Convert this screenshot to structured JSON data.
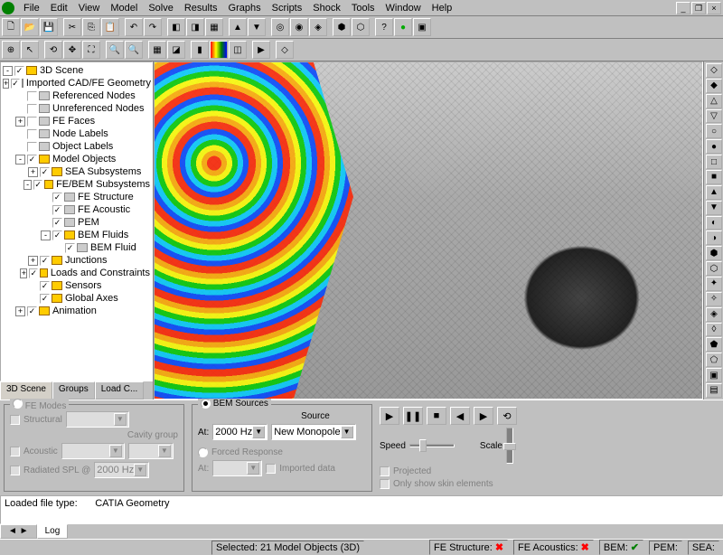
{
  "menu": [
    "File",
    "Edit",
    "View",
    "Model",
    "Solve",
    "Results",
    "Graphs",
    "Scripts",
    "Shock",
    "Tools",
    "Window",
    "Help"
  ],
  "tree": {
    "root": "3D Scene",
    "items": [
      {
        "indent": 1,
        "exp": "+",
        "chk": true,
        "icon": "gray",
        "label": "Imported CAD/FE Geometry"
      },
      {
        "indent": 1,
        "exp": "",
        "chk": false,
        "icon": "gray",
        "label": "Referenced Nodes"
      },
      {
        "indent": 1,
        "exp": "",
        "chk": false,
        "icon": "gray",
        "label": "Unreferenced Nodes"
      },
      {
        "indent": 1,
        "exp": "+",
        "chk": false,
        "icon": "gray",
        "label": "FE Faces"
      },
      {
        "indent": 1,
        "exp": "",
        "chk": false,
        "icon": "gray",
        "label": "Node Labels"
      },
      {
        "indent": 1,
        "exp": "",
        "chk": false,
        "icon": "gray",
        "label": "Object Labels"
      },
      {
        "indent": 1,
        "exp": "-",
        "chk": true,
        "icon": "gold",
        "label": "Model Objects"
      },
      {
        "indent": 2,
        "exp": "+",
        "chk": true,
        "icon": "gold",
        "label": "SEA Subsystems"
      },
      {
        "indent": 2,
        "exp": "-",
        "chk": true,
        "icon": "gold",
        "label": "FE/BEM Subsystems"
      },
      {
        "indent": 3,
        "exp": "",
        "chk": true,
        "icon": "gray",
        "label": "FE Structure"
      },
      {
        "indent": 3,
        "exp": "",
        "chk": true,
        "icon": "gray",
        "label": "FE Acoustic"
      },
      {
        "indent": 3,
        "exp": "",
        "chk": true,
        "icon": "gray",
        "label": "PEM"
      },
      {
        "indent": 3,
        "exp": "-",
        "chk": true,
        "icon": "gold",
        "label": "BEM Fluids"
      },
      {
        "indent": 4,
        "exp": "",
        "chk": true,
        "icon": "gray",
        "label": "BEM Fluid"
      },
      {
        "indent": 2,
        "exp": "+",
        "chk": true,
        "icon": "gold",
        "label": "Junctions"
      },
      {
        "indent": 2,
        "exp": "+",
        "chk": true,
        "icon": "gold",
        "label": "Loads and Constraints"
      },
      {
        "indent": 2,
        "exp": "",
        "chk": true,
        "icon": "gold",
        "label": "Sensors"
      },
      {
        "indent": 2,
        "exp": "",
        "chk": true,
        "icon": "gold",
        "label": "Global Axes"
      },
      {
        "indent": 1,
        "exp": "+",
        "chk": true,
        "icon": "gold",
        "label": "Animation"
      }
    ]
  },
  "left_tabs": [
    "3D Scene",
    "Groups",
    "Load C..."
  ],
  "bottom": {
    "fe_modes_title": "FE Modes",
    "structural": "Structural",
    "acoustic": "Acoustic",
    "radiated": "Radiated SPL @",
    "radiated_freq": "2000 Hz",
    "cavity_group": "Cavity group",
    "bem_sources_title": "BEM Sources",
    "at": "At:",
    "freq_value": "2000 Hz",
    "source_label": "Source",
    "source_value": "New Monopole",
    "forced_response": "Forced Response",
    "imported_data": "Imported data",
    "speed": "Speed",
    "scale": "Scale",
    "projected": "Projected",
    "only_skin": "Only show skin elements"
  },
  "log": {
    "loaded_label": "Loaded file type:",
    "loaded_value": "CATIA Geometry",
    "tabs_left": "◄ ►",
    "tab_log": "Log"
  },
  "status": {
    "selected": "Selected: 21 Model Objects (3D)",
    "fe_structure": "FE Structure:",
    "fe_acoustics": "FE Acoustics:",
    "bem": "BEM:",
    "pem": "PEM:",
    "sea": "SEA:"
  }
}
